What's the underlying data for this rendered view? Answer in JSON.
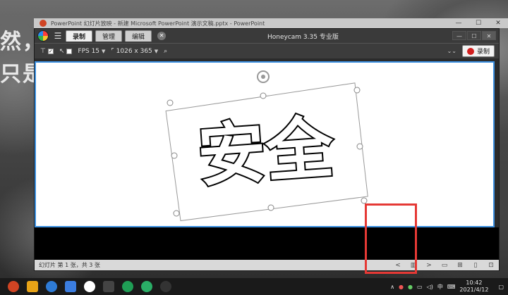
{
  "background": {
    "line1": "然，",
    "line2": "只是"
  },
  "powerpoint": {
    "title": "PowerPoint 幻灯片放映  -  新建 Microsoft PowerPoint 演示文稿.pptx - PowerPoint",
    "status": "幻灯片 第 1 张，共 3 张",
    "window_controls": [
      "—",
      "☐",
      "✕"
    ],
    "nav_prev": "<",
    "nav_menu": "▥",
    "nav_next": ">"
  },
  "honeycam": {
    "title": "Honeycam  3.35 专业版",
    "tabs": [
      "录制",
      "管理",
      "编辑"
    ],
    "active_tab": 0,
    "toolbar": {
      "fps_label": "FPS 15",
      "size_label": "1026 x 365",
      "record_label": "录制"
    },
    "window_controls": [
      "—",
      "☐",
      "✕"
    ]
  },
  "slide": {
    "text": "安全"
  },
  "taskbar": {
    "tray_lang": "中",
    "time": "10:42",
    "date": "2021/4/12"
  },
  "colors": {
    "capture_border": "#3b8fe0",
    "highlight": "#e53935",
    "record_dot": "#d21f1f"
  }
}
